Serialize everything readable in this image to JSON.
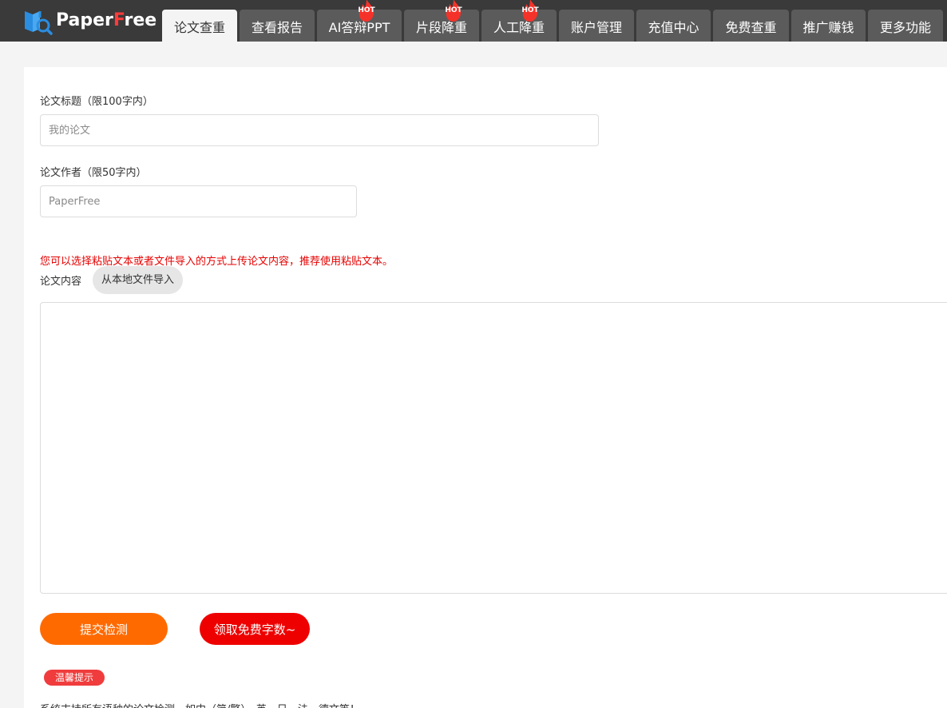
{
  "brand": {
    "name_part1": "Paper",
    "name_part2": "F",
    "name_part3": "ree",
    "logo_icon": "book-magnifier-icon",
    "accent_color": "#ff3b3b"
  },
  "nav": {
    "tabs": [
      {
        "label": "论文查重",
        "active": true,
        "hot": false
      },
      {
        "label": "查看报告",
        "active": false,
        "hot": false
      },
      {
        "label": "AI答辩PPT",
        "active": false,
        "hot": true
      },
      {
        "label": "片段降重",
        "active": false,
        "hot": true
      },
      {
        "label": "人工降重",
        "active": false,
        "hot": true
      },
      {
        "label": "账户管理",
        "active": false,
        "hot": false
      },
      {
        "label": "充值中心",
        "active": false,
        "hot": false
      },
      {
        "label": "免费查重",
        "active": false,
        "hot": false
      },
      {
        "label": "推广赚钱",
        "active": false,
        "hot": false
      },
      {
        "label": "更多功能",
        "active": false,
        "hot": false
      }
    ],
    "hot_badge_text": "HOT",
    "hot_icon": "flame-icon"
  },
  "form": {
    "title_label": "论文标题（限100字内）",
    "title_value": "",
    "title_placeholder": "我的论文",
    "author_label": "论文作者（限50字内）",
    "author_value": "",
    "author_placeholder": "PaperFree",
    "upload_notice": "您可以选择粘贴文本或者文件导入的方式上传论文内容，推荐使用粘贴文本。",
    "content_label": "论文内容",
    "import_button": "从本地文件导入",
    "content_value": ""
  },
  "actions": {
    "submit_label": "提交检测",
    "free_words_label": "领取免费字数~",
    "submit_color": "#ff6a00",
    "free_color": "#ee0000"
  },
  "tips": {
    "badge_label": "温馨提示",
    "support_text": "系统支持所有语种的论文检测，如中（简/繁）、英、日、法、德文等！"
  }
}
